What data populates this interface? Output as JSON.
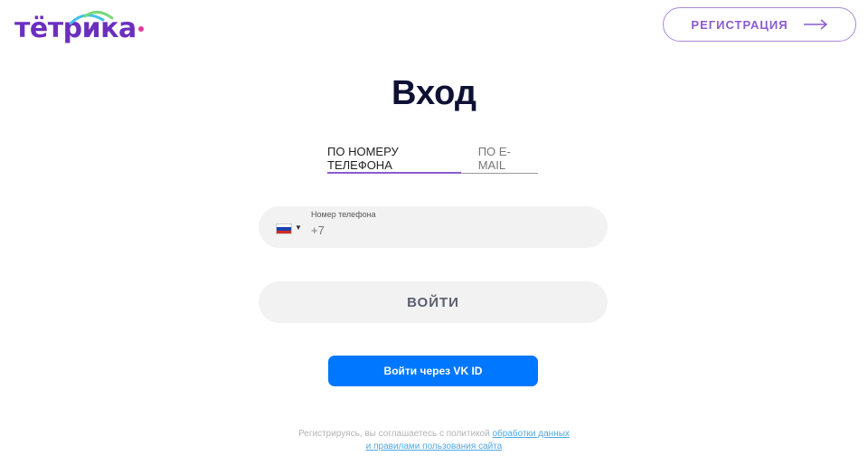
{
  "header": {
    "logo_text": "тётрика",
    "register_label": "РЕГИСТРАЦИЯ"
  },
  "main": {
    "title": "Вход",
    "tabs": [
      {
        "label": "ПО НОМЕРУ ТЕЛЕФОНА",
        "active": true
      },
      {
        "label": "ПО E-MAIL",
        "active": false
      }
    ],
    "phone": {
      "label": "Номер телефона",
      "value": "+7",
      "country": "russia-flag-icon"
    },
    "login_label": "ВОЙТИ",
    "vk_label": "Войти через VK ID"
  },
  "footer": {
    "legal_text": "Регистрируясь, вы соглашаетесь с политикой",
    "link_1": "обработки данных",
    "link_2": "и правилами пользования сайта"
  },
  "colors": {
    "brand_purple": "#6b2fbf",
    "accent_pink": "#e4389b",
    "vk_blue": "#0077ff",
    "title_dark": "#0e1133"
  }
}
